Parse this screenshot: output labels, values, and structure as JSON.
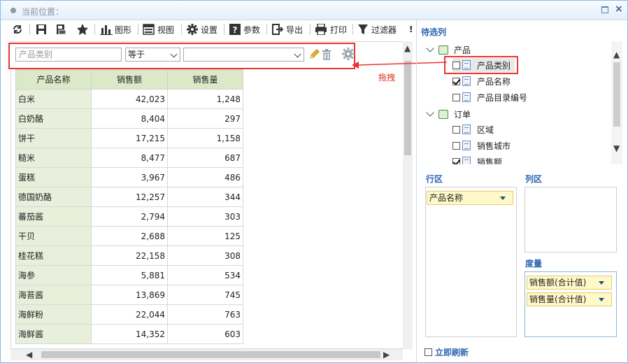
{
  "window": {
    "title": "当前位置：",
    "restore_icon": "restore-icon",
    "close_glyph": "×"
  },
  "toolbar": {
    "chart_label": "图形",
    "view_label": "视图",
    "settings_label": "设置",
    "params_label": "参数",
    "export_label": "导出",
    "print_label": "打印",
    "filter_label": "过滤器",
    "more_glyph": "!"
  },
  "filter": {
    "field_placeholder": "产品类别",
    "operator_value": "等于",
    "value_value": ""
  },
  "annotation": {
    "drag_label": "拖拽"
  },
  "table": {
    "headers": [
      "产品名称",
      "销售额",
      "销售量"
    ],
    "rows": [
      [
        "白米",
        "42,023",
        "1,248"
      ],
      [
        "白奶酪",
        "8,404",
        "297"
      ],
      [
        "饼干",
        "17,215",
        "1,158"
      ],
      [
        "糙米",
        "8,477",
        "687"
      ],
      [
        "蛋糕",
        "3,967",
        "486"
      ],
      [
        "德国奶酪",
        "12,257",
        "344"
      ],
      [
        "蕃茄酱",
        "2,794",
        "303"
      ],
      [
        "干贝",
        "2,688",
        "125"
      ],
      [
        "桂花糕",
        "22,158",
        "308"
      ],
      [
        "海参",
        "5,881",
        "534"
      ],
      [
        "海苔酱",
        "13,869",
        "745"
      ],
      [
        "海鲜粉",
        "22,044",
        "763"
      ],
      [
        "海鲜酱",
        "14,352",
        "603"
      ]
    ]
  },
  "right_panel": {
    "available_title": "待选列",
    "tree": {
      "group1": "产品",
      "group1_items": [
        {
          "label": "产品类别",
          "checked": false
        },
        {
          "label": "产品名称",
          "checked": true
        },
        {
          "label": "产品目录编号",
          "checked": false
        }
      ],
      "group2": "订单",
      "group2_items": [
        {
          "label": "区域",
          "checked": false
        },
        {
          "label": "销售城市",
          "checked": false
        },
        {
          "label": "销售额",
          "checked": true
        }
      ]
    },
    "row_zone_title": "行区",
    "row_zone_items": [
      "产品名称"
    ],
    "col_zone_title": "列区",
    "measure_title": "度量",
    "measure_items": [
      "销售额(合计值)",
      "销售量(合计值)"
    ],
    "refresh_label": "立即刷新"
  },
  "colors": {
    "accent": "#2b62b3",
    "highlight": "#e33333",
    "header_green": "#dce9c9",
    "pill_yellow": "#fff8c8"
  }
}
